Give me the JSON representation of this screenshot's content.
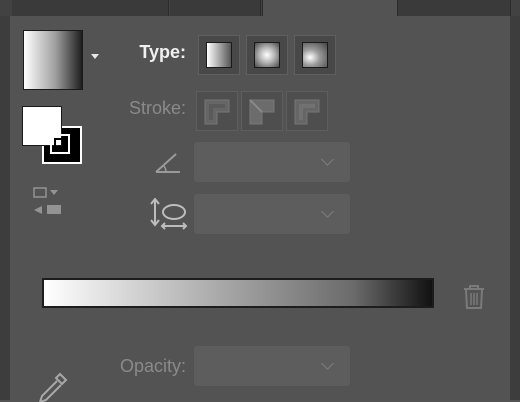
{
  "panel": {
    "type_label": "Type:",
    "stroke_label": "Stroke:",
    "opacity_label": "Opacity:",
    "angle_value": "",
    "aspect_value": "",
    "opacity_value": ""
  },
  "type_options": [
    "linear-gradient",
    "radial-gradient",
    "freeform-gradient"
  ],
  "stroke_options": [
    "apply-within-stroke",
    "apply-along-stroke",
    "apply-across-stroke"
  ],
  "gradient": {
    "start_color": "#ffffff",
    "end_color": "#111111"
  },
  "icons": [
    "swatch-caret",
    "fill-stroke",
    "swap-gradient",
    "angle",
    "aspect-ratio",
    "chevron-down",
    "trash",
    "eyedropper"
  ]
}
